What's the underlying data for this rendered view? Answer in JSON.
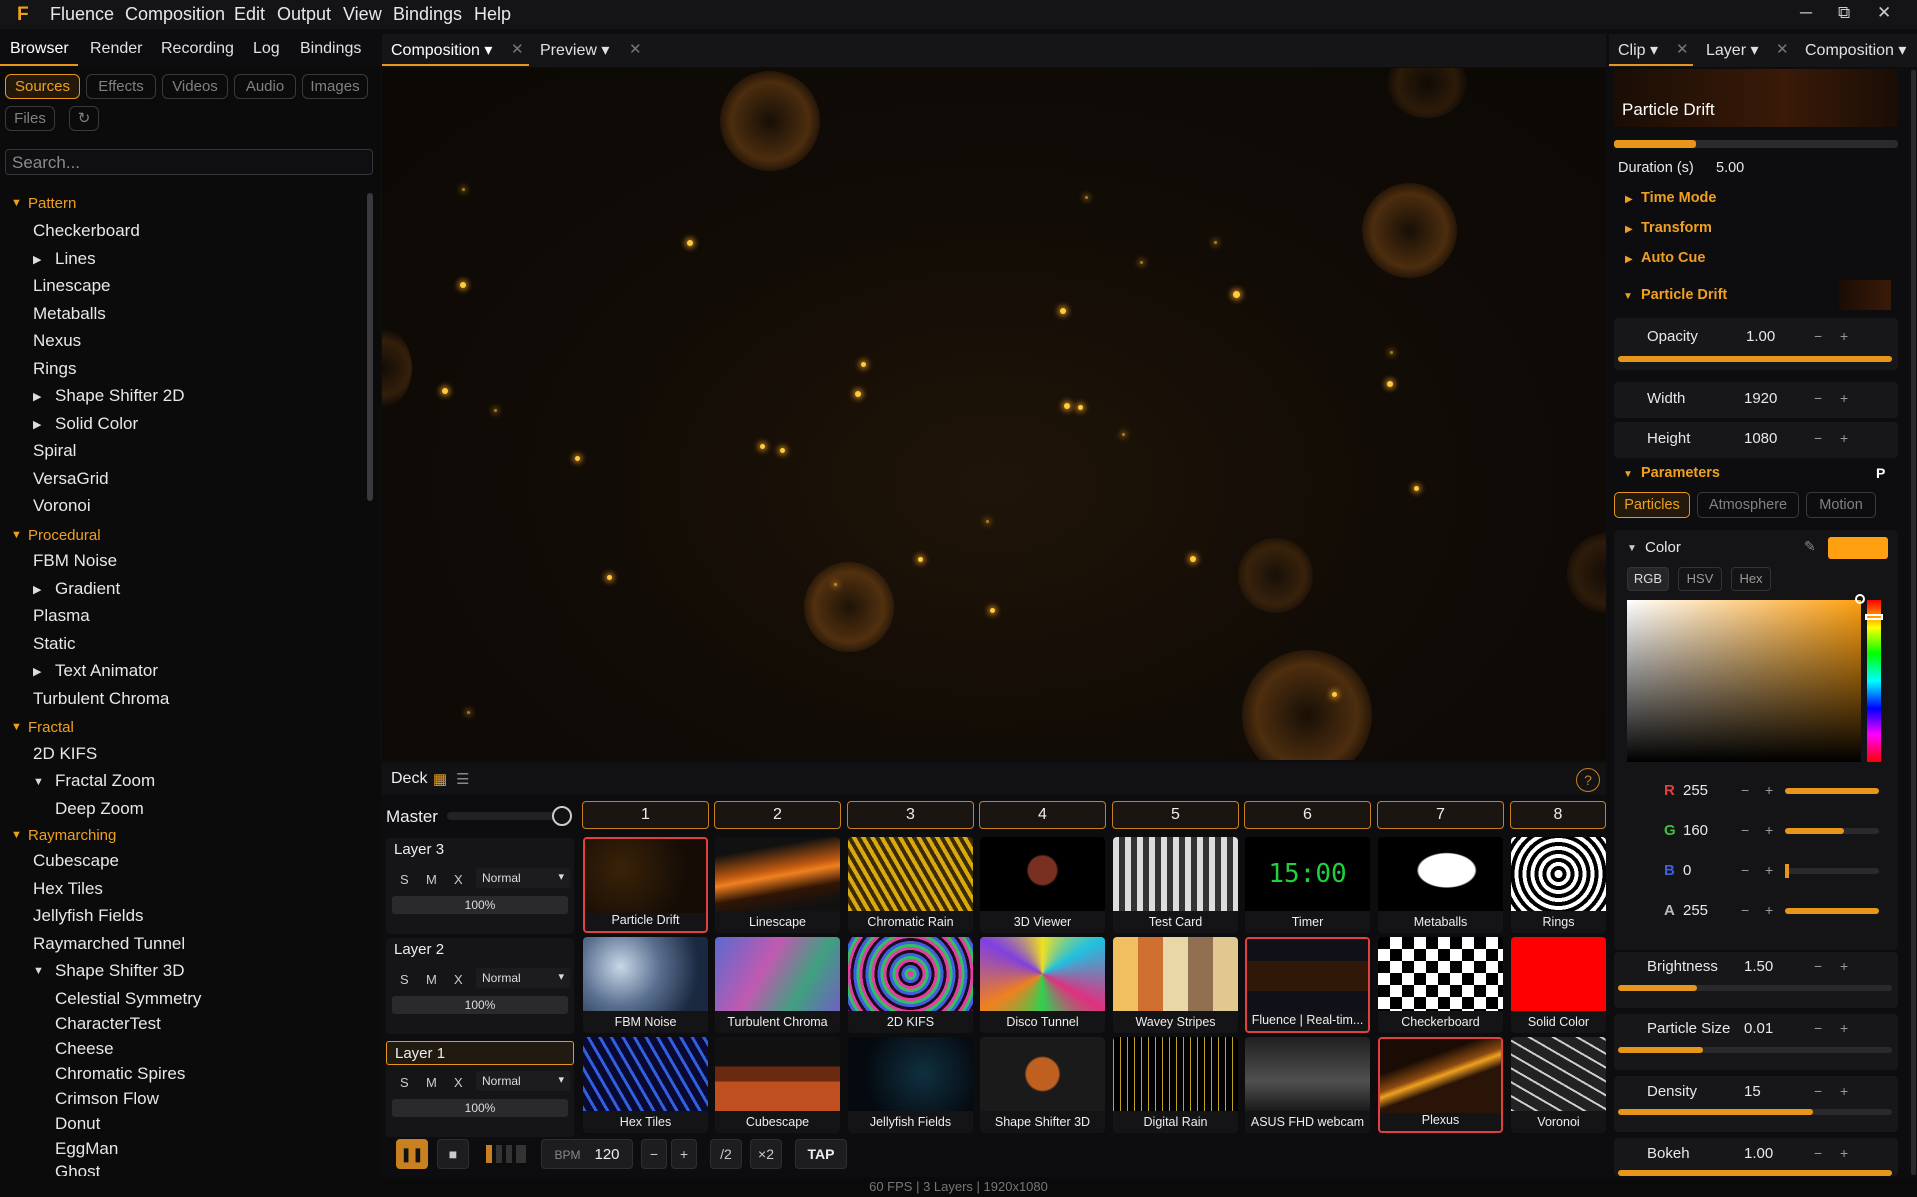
{
  "app": {
    "name": "Fluence"
  },
  "menu": [
    "Fluence",
    "Composition",
    "Edit",
    "Output",
    "View",
    "Bindings",
    "Help"
  ],
  "left_tabs": [
    "Browser",
    "Render",
    "Recording",
    "Log",
    "Bindings"
  ],
  "filters": [
    "Sources",
    "Effects",
    "Videos",
    "Audio",
    "Images",
    "Files"
  ],
  "search": {
    "placeholder": "Search..."
  },
  "tree": {
    "pattern": {
      "label": "Pattern",
      "items": [
        "Checkerboard",
        "Lines",
        "Linescape",
        "Metaballs",
        "Nexus",
        "Rings",
        "Shape Shifter 2D",
        "Solid Color",
        "Spiral",
        "VersaGrid",
        "Voronoi"
      ]
    },
    "procedural": {
      "label": "Procedural",
      "items": [
        "FBM Noise",
        "Gradient",
        "Plasma",
        "Static",
        "Text Animator",
        "Turbulent Chroma"
      ]
    },
    "fractal": {
      "label": "Fractal",
      "items": [
        "2D KIFS",
        "Fractal Zoom",
        "Deep Zoom"
      ]
    },
    "raymarching": {
      "label": "Raymarching",
      "items": [
        "Cubescape",
        "Hex Tiles",
        "Jellyfish Fields",
        "Raymarched Tunnel",
        "Shape Shifter 3D",
        "Celestial Symmetry",
        "CharacterTest",
        "Cheese",
        "Chromatic Spires",
        "Crimson Flow",
        "Donut",
        "EggMan",
        "Ghost"
      ]
    }
  },
  "center_tabs": {
    "composition": "Composition",
    "preview": "Preview"
  },
  "deck": {
    "label": "Deck",
    "help": "?",
    "master": "Master",
    "columns": [
      "1",
      "2",
      "3",
      "4",
      "5",
      "6",
      "7",
      "8"
    ],
    "layers": [
      {
        "name": "Layer 3",
        "s": "S",
        "m": "M",
        "x": "X",
        "blend": "Normal",
        "opacity": "100%",
        "clips": [
          "Particle Drift",
          "Linescape",
          "Chromatic Rain",
          "3D Viewer",
          "Test Card",
          "Timer",
          "Metaballs",
          "Rings"
        ]
      },
      {
        "name": "Layer 2",
        "s": "S",
        "m": "M",
        "x": "X",
        "blend": "Normal",
        "opacity": "100%",
        "clips": [
          "FBM Noise",
          "Turbulent Chroma",
          "2D KIFS",
          "Disco Tunnel",
          "Wavey Stripes",
          "Fluence | Real-tim...",
          "Checkerboard",
          "Solid Color"
        ]
      },
      {
        "name": "Layer 1",
        "s": "S",
        "m": "M",
        "x": "X",
        "blend": "Normal",
        "opacity": "100%",
        "clips": [
          "Hex Tiles",
          "Cubescape",
          "Jellyfish Fields",
          "Shape Shifter 3D",
          "Digital Rain",
          "ASUS FHD webcam",
          "Plexus",
          "Voronoi"
        ]
      }
    ],
    "timer_text": "15:00"
  },
  "transport": {
    "bpm_label": "BPM",
    "bpm": "120",
    "minus": "−",
    "plus": "+",
    "half": "/2",
    "double": "×2",
    "tap": "TAP"
  },
  "status": "60 FPS  |  3 Layers  |  1920x1080",
  "right_tabs": [
    "Clip",
    "Layer",
    "Composition"
  ],
  "clip": {
    "name": "Particle Drift",
    "progress": 0.29,
    "duration_label": "Duration (s)",
    "duration": "5.00",
    "sections": [
      "Time Mode",
      "Transform",
      "Auto Cue",
      "Particle Drift"
    ],
    "opacity": {
      "label": "Opacity",
      "value": "1.00",
      "fraction": 1.0
    },
    "width": {
      "label": "Width",
      "value": "1920"
    },
    "height": {
      "label": "Height",
      "value": "1080"
    },
    "parameters": {
      "label": "Parameters",
      "badge": "P"
    },
    "subtabs": [
      "Particles",
      "Atmosphere",
      "Motion"
    ],
    "color": {
      "label": "Color",
      "swatch": "#ffa010",
      "modes": [
        "RGB",
        "HSV",
        "Hex"
      ],
      "r": {
        "label": "R",
        "value": "255",
        "fraction": 1.0
      },
      "g": {
        "label": "G",
        "value": "160",
        "fraction": 0.63
      },
      "b": {
        "label": "B",
        "value": "0",
        "fraction": 0.0
      },
      "a": {
        "label": "A",
        "value": "255",
        "fraction": 1.0
      }
    },
    "brightness": {
      "label": "Brightness",
      "value": "1.50",
      "fraction": 0.29
    },
    "particle_size": {
      "label": "Particle Size",
      "value": "0.01",
      "fraction": 0.31
    },
    "density": {
      "label": "Density",
      "value": "15",
      "fraction": 0.71
    },
    "bokeh": {
      "label": "Bokeh",
      "value": "1.00",
      "fraction": 1.0
    }
  },
  "colors": {
    "accent": "#e8961a",
    "accent_text": "#f0a020",
    "active_clip_border": "#e04040"
  }
}
